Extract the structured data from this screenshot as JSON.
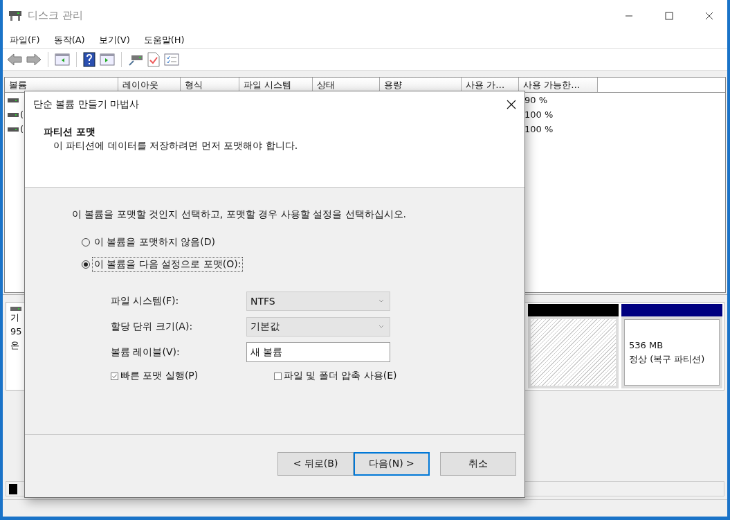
{
  "window": {
    "title": "디스크 관리"
  },
  "menu": [
    {
      "label": "파일(F)"
    },
    {
      "label": "동작(A)"
    },
    {
      "label": "보기(V)"
    },
    {
      "label": "도움말(H)"
    }
  ],
  "volume_table": {
    "columns": [
      "볼륨",
      "레이아웃",
      "형식",
      "파일 시스템",
      "상태",
      "용량",
      "사용 가…",
      "사용 가능한…"
    ],
    "rows": [
      {
        "percent_free": "90 %"
      },
      {
        "volume": "(",
        "percent_free": "100 %"
      },
      {
        "volume": "(",
        "percent_free": "100 %"
      }
    ]
  },
  "disk_pane": {
    "disk_lines": [
      "기",
      "95",
      "온"
    ],
    "partitions": [
      {
        "kind": "unallocated",
        "color": "#000000"
      },
      {
        "kind": "recovery",
        "color": "#000080",
        "size": "536 MB",
        "status": "정상 (복구 파티션)"
      }
    ],
    "legend": [
      {
        "color": "#000000"
      }
    ]
  },
  "dialog": {
    "title": "단순 볼륨 만들기 마법사",
    "heading": "파티션 포맷",
    "subheading": "이 파티션에 데이터를 저장하려면 먼저 포맷해야 합니다.",
    "instruction": "이 볼륨을 포맷할 것인지 선택하고, 포맷할 경우 사용할 설정을 선택하십시오.",
    "options": [
      {
        "label": "이 볼륨을 포맷하지 않음(D)",
        "selected": false,
        "focused": false
      },
      {
        "label": "이 볼륨을 다음 설정으로 포맷(O):",
        "selected": true,
        "focused": true
      }
    ],
    "settings": [
      {
        "kind": "dropdown",
        "label": "파일 시스템(F):",
        "value": "NTFS"
      },
      {
        "kind": "dropdown",
        "label": "할당 단위 크기(A):",
        "value": "기본값"
      },
      {
        "kind": "text",
        "label": "볼륨 레이블(V):",
        "value": "새 볼륨"
      }
    ],
    "checkboxes": [
      {
        "label": "빠른 포맷 실행(P)",
        "checked": true
      },
      {
        "label": "파일 및 폴더 압축 사용(E)",
        "checked": false
      }
    ],
    "buttons": [
      {
        "label": "< 뒤로(B)",
        "default": false
      },
      {
        "label": "다음(N) >",
        "default": true
      },
      {
        "label": "취소",
        "default": false
      }
    ]
  }
}
